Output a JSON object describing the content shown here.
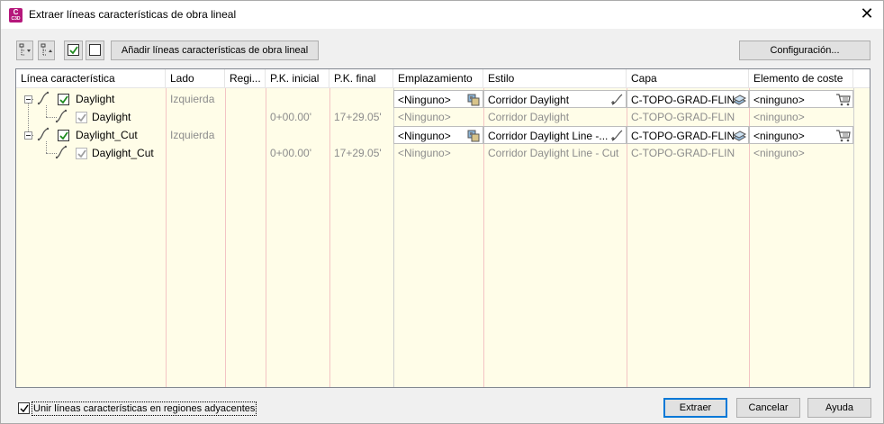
{
  "window": {
    "title": "Extraer líneas características de obra lineal",
    "app_icon_letter": "C",
    "app_icon_sub": "C3D"
  },
  "toolbar": {
    "add_button_label": "Añadir líneas características de obra lineal",
    "config_button_label": "Configuración..."
  },
  "grid": {
    "columns": [
      "Línea característica",
      "Lado",
      "Regi...",
      "P.K. inicial",
      "P.K. final",
      "Emplazamiento",
      "Estilo",
      "Capa",
      "Elemento de coste"
    ],
    "rows": [
      {
        "name": "Daylight",
        "lado": "Izquierda",
        "region": "",
        "pk_inicial": "",
        "pk_final": "",
        "emplazamiento": "<Ninguno>",
        "estilo": "Corridor Daylight",
        "capa": "C-TOPO-GRAD-FLIN",
        "coste": "<ninguno>",
        "checked": true,
        "level": 0
      },
      {
        "name": "Daylight",
        "lado": "",
        "region": "",
        "pk_inicial": "0+00.00'",
        "pk_final": "17+29.05'",
        "emplazamiento": "<Ninguno>",
        "estilo": "Corridor Daylight",
        "capa": "C-TOPO-GRAD-FLIN",
        "coste": "<ninguno>",
        "checked": true,
        "level": 1
      },
      {
        "name": "Daylight_Cut",
        "lado": "Izquierda",
        "region": "",
        "pk_inicial": "",
        "pk_final": "",
        "emplazamiento": "<Ninguno>",
        "estilo": "Corridor Daylight Line -...",
        "capa": "C-TOPO-GRAD-FLIN",
        "coste": "<ninguno>",
        "checked": true,
        "level": 0
      },
      {
        "name": "Daylight_Cut",
        "lado": "",
        "region": "",
        "pk_inicial": "0+00.00'",
        "pk_final": "17+29.05'",
        "emplazamiento": "<Ninguno>",
        "estilo": "Corridor Daylight Line - Cut",
        "capa": "C-TOPO-GRAD-FLIN",
        "coste": "<ninguno>",
        "checked": true,
        "level": 1
      }
    ]
  },
  "footer": {
    "join_checkbox_label": "Unir líneas características en regiones adyacentes",
    "join_checked": true,
    "extract_label": "Extraer",
    "cancel_label": "Cancelar",
    "help_label": "Ayuda"
  },
  "colors": {
    "grid_background": "#fffde8",
    "app_icon": "#b5177b",
    "checkmark": "#1e8a1e",
    "primary_border": "#0078d7"
  }
}
